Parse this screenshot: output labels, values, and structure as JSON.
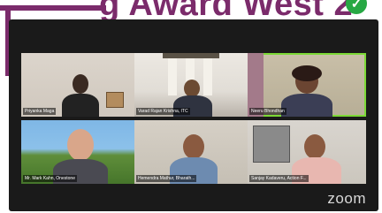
{
  "banner": {
    "text": "g Award West 2",
    "check": "✓"
  },
  "colors": {
    "accent": "#7b2b6b",
    "active_speaker": "#7cd936",
    "check": "#27a844"
  },
  "participants": [
    {
      "name": "Priyanka Maga"
    },
    {
      "name": "Varad Rajan Krishna, ITC"
    },
    {
      "name": "Neeru Bhondhan"
    },
    {
      "name": "Mr. Mark Kahn, Onestone"
    },
    {
      "name": "Hemendra Mathur, Bharath..."
    },
    {
      "name": "Sanjay Kadaveru, Action F..."
    }
  ],
  "active_speaker_index": 2,
  "zoom_logo": "zoom"
}
